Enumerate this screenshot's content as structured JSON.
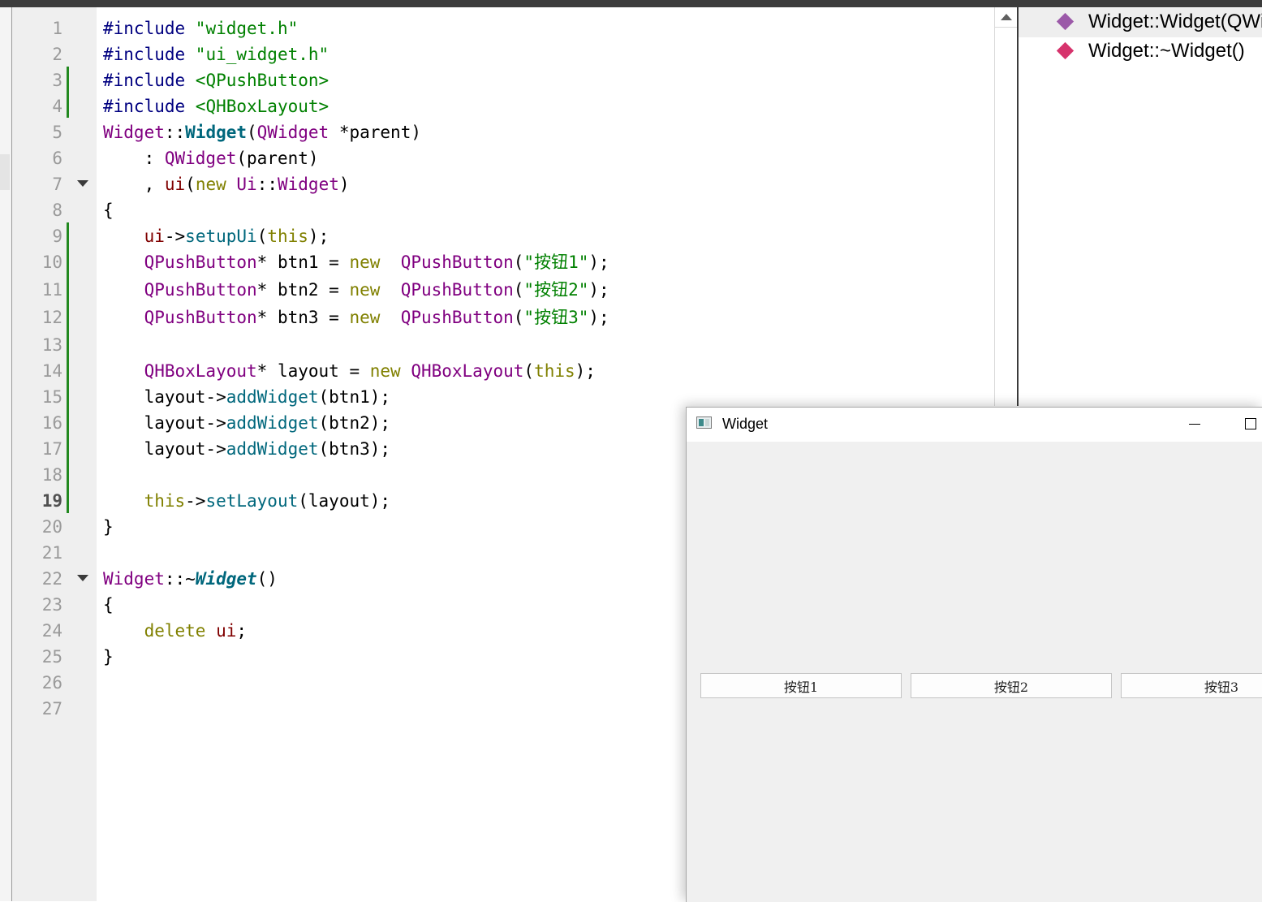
{
  "editor": {
    "line_numbers": [
      "1",
      "2",
      "3",
      "4",
      "5",
      "6",
      "7",
      "8",
      "9",
      "10",
      "11",
      "12",
      "13",
      "14",
      "15",
      "16",
      "17",
      "18",
      "19",
      "20",
      "21",
      "22",
      "23",
      "24",
      "25",
      "26",
      "27"
    ],
    "current_line": "19",
    "code": {
      "l1_a": "#include ",
      "l1_b": "\"widget.h\"",
      "l2_a": "#include ",
      "l2_b": "\"ui_widget.h\"",
      "l3_a": "#include ",
      "l3_b": "<QPushButton>",
      "l4_a": "#include ",
      "l4_b": "<QHBoxLayout>",
      "l5_a": "Widget",
      "l5_b": "::",
      "l5_c": "Widget",
      "l5_d": "(",
      "l5_e": "QWidget",
      "l5_f": " *parent)",
      "l6_a": "    : ",
      "l6_b": "QWidget",
      "l6_c": "(parent)",
      "l7_a": "    , ",
      "l7_b": "ui",
      "l7_c": "(",
      "l7_d": "new",
      "l7_e": " ",
      "l7_f": "Ui",
      "l7_g": "::",
      "l7_h": "Widget",
      "l7_i": ")",
      "l8_a": "{",
      "l9_a": "    ",
      "l9_b": "ui",
      "l9_c": "->",
      "l9_d": "setupUi",
      "l9_e": "(",
      "l9_f": "this",
      "l9_g": ");",
      "l10_a": "    ",
      "l10_b": "QPushButton",
      "l10_c": "* btn1 = ",
      "l10_d": "new",
      "l10_e": "  ",
      "l10_f": "QPushButton",
      "l10_g": "(",
      "l10_h": "\"按钮1\"",
      "l10_i": ");",
      "l11_a": "    ",
      "l11_b": "QPushButton",
      "l11_c": "* btn2 = ",
      "l11_d": "new",
      "l11_e": "  ",
      "l11_f": "QPushButton",
      "l11_g": "(",
      "l11_h": "\"按钮2\"",
      "l11_i": ");",
      "l12_a": "    ",
      "l12_b": "QPushButton",
      "l12_c": "* btn3 = ",
      "l12_d": "new",
      "l12_e": "  ",
      "l12_f": "QPushButton",
      "l12_g": "(",
      "l12_h": "\"按钮3\"",
      "l12_i": ");",
      "l14_a": "    ",
      "l14_b": "QHBoxLayout",
      "l14_c": "* layout = ",
      "l14_d": "new",
      "l14_e": " ",
      "l14_f": "QHBoxLayout",
      "l14_g": "(",
      "l14_h": "this",
      "l14_i": ");",
      "l15_a": "    layout->",
      "l15_b": "addWidget",
      "l15_c": "(btn1);",
      "l16_a": "    layout->",
      "l16_b": "addWidget",
      "l16_c": "(btn2);",
      "l17_a": "    layout->",
      "l17_b": "addWidget",
      "l17_c": "(btn3);",
      "l19_a": "    ",
      "l19_b": "this",
      "l19_c": "->",
      "l19_d": "setLayout",
      "l19_e": "(layout);",
      "l20_a": "}",
      "l22_a": "Widget",
      "l22_b": "::~",
      "l22_c": "Widget",
      "l22_d": "()",
      "l23_a": "{",
      "l24_a": "    ",
      "l24_b": "delete",
      "l24_c": " ",
      "l24_d": "ui",
      "l24_e": ";",
      "l25_a": "}"
    }
  },
  "outline": {
    "items": [
      {
        "label": "Widget::Widget(QWidget *parent)",
        "icon": "method-diamond-icon",
        "color": "#9b59a8"
      },
      {
        "label": "Widget::~Widget()",
        "icon": "method-diamond-icon",
        "color": "#d6336c"
      }
    ]
  },
  "widget_window": {
    "title": "Widget",
    "buttons": [
      "按钮1",
      "按钮2",
      "按钮3"
    ]
  }
}
